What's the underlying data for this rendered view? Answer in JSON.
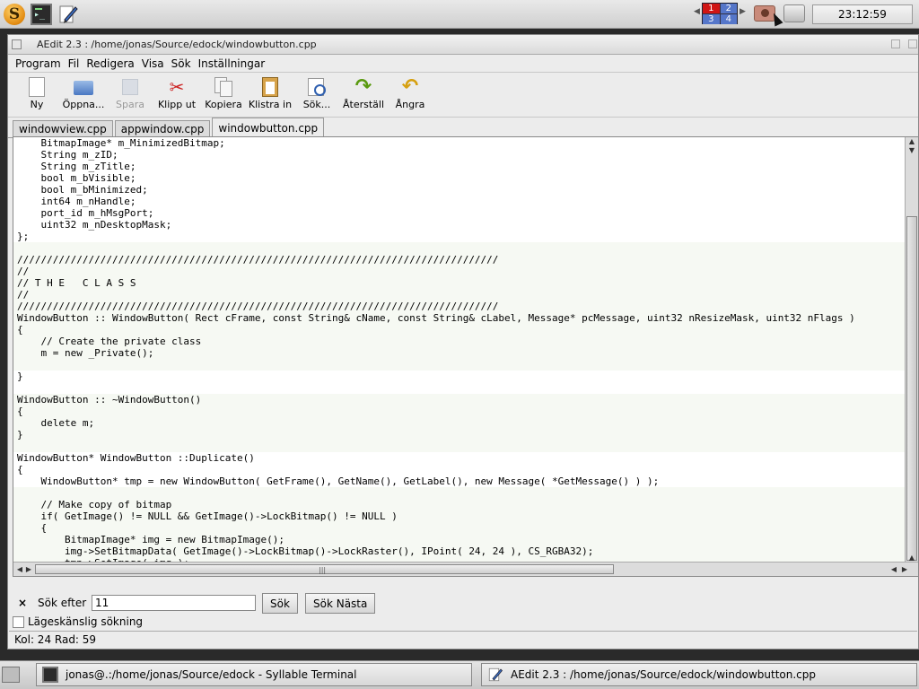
{
  "topbar": {
    "workspaces": [
      "1",
      "2",
      "3",
      "4"
    ],
    "clock": "23:12:59"
  },
  "window": {
    "title": "AEdit 2.3 : /home/jonas/Source/edock/windowbutton.cpp"
  },
  "menu": [
    "Program",
    "Fil",
    "Redigera",
    "Visa",
    "Sök",
    "Inställningar"
  ],
  "toolbar": [
    {
      "label": "Ny",
      "icon": "new-file-icon",
      "enabled": true
    },
    {
      "label": "Öppna...",
      "icon": "open-folder-icon",
      "enabled": true
    },
    {
      "label": "Spara",
      "icon": "save-icon",
      "enabled": false
    },
    {
      "label": "Klipp ut",
      "icon": "cut-icon",
      "enabled": true
    },
    {
      "label": "Kopiera",
      "icon": "copy-icon",
      "enabled": true
    },
    {
      "label": "Klistra in",
      "icon": "paste-icon",
      "enabled": true
    },
    {
      "label": "Sök...",
      "icon": "search-icon",
      "enabled": true
    },
    {
      "label": "Återställ",
      "icon": "redo-icon",
      "enabled": true
    },
    {
      "label": "Ångra",
      "icon": "undo-icon",
      "enabled": true
    }
  ],
  "tabs": [
    {
      "label": "windowview.cpp",
      "active": false
    },
    {
      "label": "appwindow.cpp",
      "active": false
    },
    {
      "label": "windowbutton.cpp",
      "active": true
    }
  ],
  "code_lines": [
    "    BitmapImage* m_MinimizedBitmap;",
    "    String m_zID;",
    "    String m_zTitle;",
    "    bool m_bVisible;",
    "    bool m_bMinimized;",
    "    int64 m_nHandle;",
    "    port_id m_hMsgPort;",
    "    uint32 m_nDesktopMask;",
    "};",
    "",
    "/////////////////////////////////////////////////////////////////////////////////",
    "//",
    "// T H E   C L A S S",
    "//",
    "/////////////////////////////////////////////////////////////////////////////////",
    "WindowButton :: WindowButton( Rect cFrame, const String& cName, const String& cLabel, Message* pcMessage, uint32 nResizeMask, uint32 nFlags )",
    "{",
    "    // Create the private class",
    "    m = new _Private();",
    "",
    "}",
    "",
    "WindowButton :: ~WindowButton()",
    "{",
    "    delete m;",
    "}",
    "",
    "WindowButton* WindowButton ::Duplicate()",
    "{",
    "    WindowButton* tmp = new WindowButton( GetFrame(), GetName(), GetLabel(), new Message( *GetMessage() ) );",
    "",
    "    // Make copy of bitmap",
    "    if( GetImage() != NULL && GetImage()->LockBitmap() != NULL )",
    "    {",
    "        BitmapImage* img = new BitmapImage();",
    "        img->SetBitmapData( GetImage()->LockBitmap()->LockRaster(), IPoint( 24, 24 ), CS_RGBA32);",
    "        tmp->SetImage( img );",
    "    }"
  ],
  "find": {
    "close_glyph": "×",
    "label": "Sök efter",
    "value": "11",
    "search_button": "Sök",
    "search_next_button": "Sök Nästa"
  },
  "case_label": "Lägeskänslig sökning",
  "status": "Kol: 24 Rad: 59",
  "taskbar": [
    {
      "label": "jonas@.:/home/jonas/Source/edock - Syllable Terminal",
      "icon": "terminal-icon"
    },
    {
      "label": "AEdit 2.3 : /home/jonas/Source/edock/windowbutton.cpp",
      "icon": "editor-icon"
    }
  ],
  "colors": {
    "workspace_active": "#d01515",
    "workspace_inactive": "#5576c9"
  }
}
